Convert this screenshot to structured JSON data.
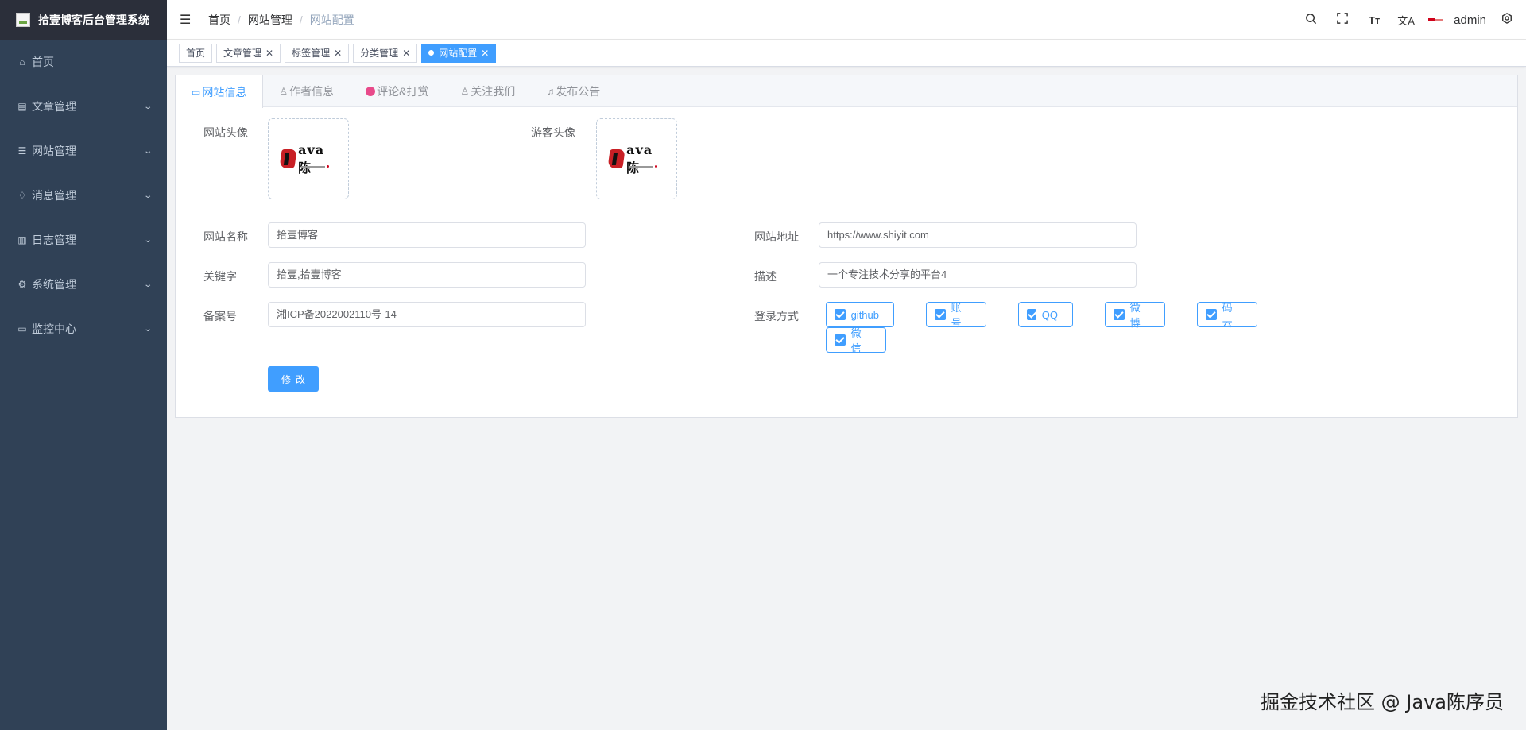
{
  "app": {
    "title": "拾壹博客后台管理系统"
  },
  "sidebar": {
    "items": [
      {
        "label": "首页",
        "icon": "home-icon",
        "glyph": "⌂",
        "expandable": false
      },
      {
        "label": "文章管理",
        "icon": "document-icon",
        "glyph": "▤",
        "expandable": true
      },
      {
        "label": "网站管理",
        "icon": "database-icon",
        "glyph": "☰",
        "expandable": true
      },
      {
        "label": "消息管理",
        "icon": "bell-icon",
        "glyph": "♫",
        "expandable": true
      },
      {
        "label": "日志管理",
        "icon": "log-icon",
        "glyph": "▥",
        "expandable": true
      },
      {
        "label": "系统管理",
        "icon": "gear-icon",
        "glyph": "⚙",
        "expandable": true
      },
      {
        "label": "监控中心",
        "icon": "monitor-icon",
        "glyph": "▭",
        "expandable": true
      }
    ]
  },
  "header": {
    "breadcrumb": [
      "首页",
      "网站管理",
      "网站配置"
    ],
    "separator": "/",
    "user": "admin"
  },
  "tags": [
    {
      "label": "首页",
      "closable": false,
      "active": false
    },
    {
      "label": "文章管理",
      "closable": true,
      "active": false
    },
    {
      "label": "标签管理",
      "closable": true,
      "active": false
    },
    {
      "label": "分类管理",
      "closable": true,
      "active": false
    },
    {
      "label": "网站配置",
      "closable": true,
      "active": true
    }
  ],
  "tabs": [
    {
      "label": "网站信息",
      "icon": "monitor-icon",
      "active": true
    },
    {
      "label": "作者信息",
      "icon": "user-icon",
      "active": false
    },
    {
      "label": "评论&打赏",
      "icon": "comment-icon",
      "active": false
    },
    {
      "label": "关注我们",
      "icon": "users-icon",
      "active": false
    },
    {
      "label": "发布公告",
      "icon": "bell-icon",
      "active": false
    }
  ],
  "form": {
    "site_avatar_label": "网站头像",
    "guest_avatar_label": "游客头像",
    "avatar_logo_text": "ava陈",
    "site_name_label": "网站名称",
    "site_name_value": "拾壹博客",
    "site_url_label": "网站地址",
    "site_url_value": "https://www.shiyit.com",
    "keywords_label": "关键字",
    "keywords_value": "拾壹,拾壹博客",
    "description_label": "描述",
    "description_value": "一个专注技术分享的平台4",
    "icp_label": "备案号",
    "icp_value": "湘ICP备2022002110号-14",
    "login_label": "登录方式",
    "login_options": [
      {
        "label": "github",
        "checked": true
      },
      {
        "label": "账号",
        "checked": true
      },
      {
        "label": "QQ",
        "checked": true
      },
      {
        "label": "微博",
        "checked": true
      },
      {
        "label": "码云",
        "checked": true
      },
      {
        "label": "微信",
        "checked": true
      }
    ],
    "submit_label": "修改"
  },
  "watermark": "掘金技术社区 @ Java陈序员",
  "colors": {
    "primary": "#409eff",
    "sidebar_bg": "#304156",
    "logo_bg": "#2b2f3a"
  }
}
